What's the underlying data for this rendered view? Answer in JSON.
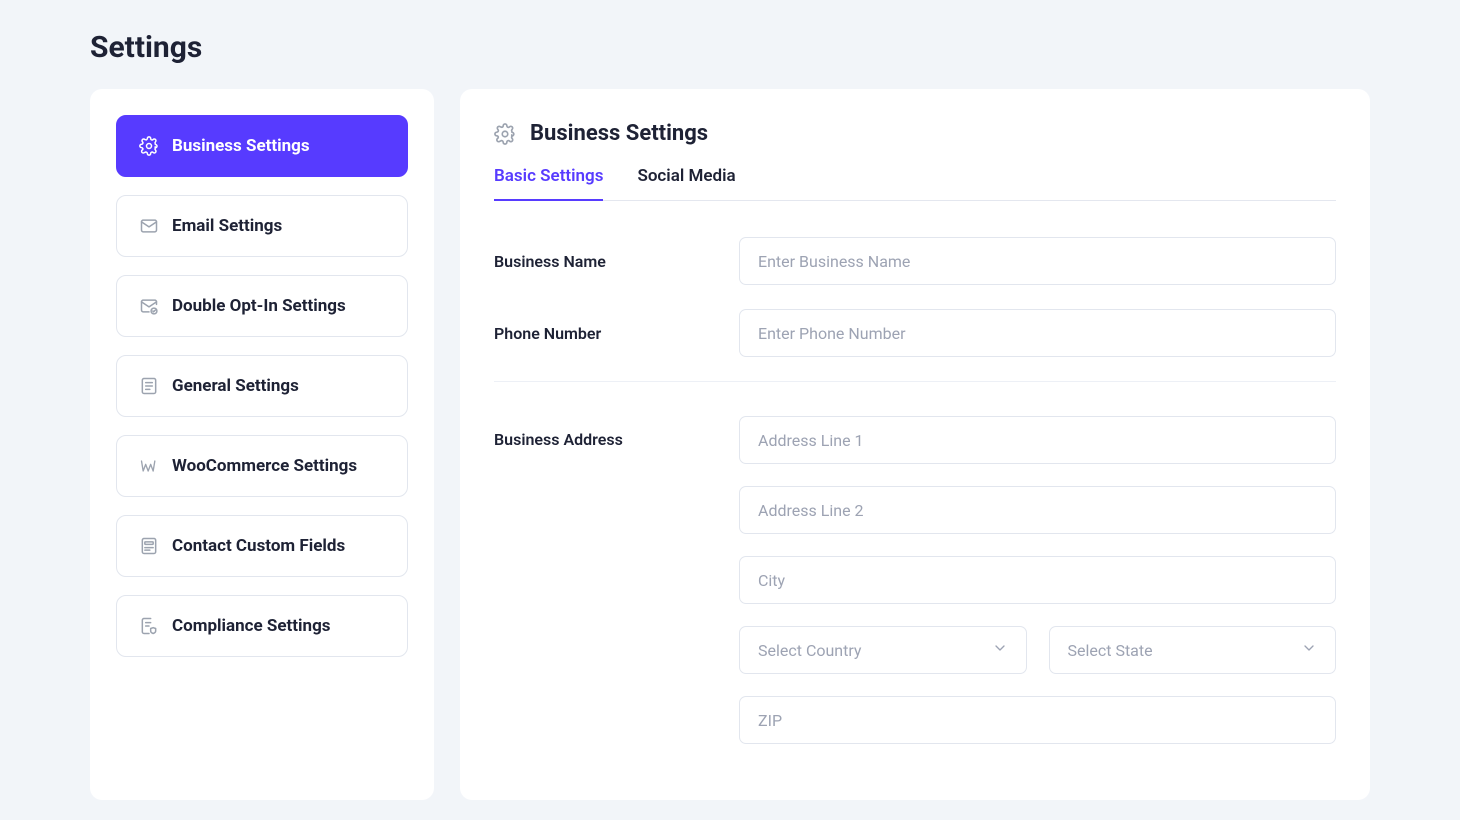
{
  "page": {
    "title": "Settings"
  },
  "sidebar": {
    "items": [
      {
        "label": "Business Settings"
      },
      {
        "label": "Email Settings"
      },
      {
        "label": "Double Opt-In Settings"
      },
      {
        "label": "General Settings"
      },
      {
        "label": "WooCommerce Settings"
      },
      {
        "label": "Contact Custom Fields"
      },
      {
        "label": "Compliance Settings"
      }
    ]
  },
  "panel": {
    "title": "Business Settings",
    "tabs": [
      {
        "label": "Basic Settings"
      },
      {
        "label": "Social Media"
      }
    ]
  },
  "form": {
    "labels": {
      "business_name": "Business Name",
      "phone_number": "Phone Number",
      "business_address": "Business Address"
    },
    "placeholders": {
      "business_name": "Enter Business Name",
      "phone_number": "Enter Phone Number",
      "address_line_1": "Address Line 1",
      "address_line_2": "Address Line 2",
      "city": "City",
      "country": "Select Country",
      "state": "Select State",
      "zip": "ZIP"
    },
    "values": {
      "business_name": "",
      "phone_number": "",
      "address_line_1": "",
      "address_line_2": "",
      "city": "",
      "zip": ""
    }
  }
}
